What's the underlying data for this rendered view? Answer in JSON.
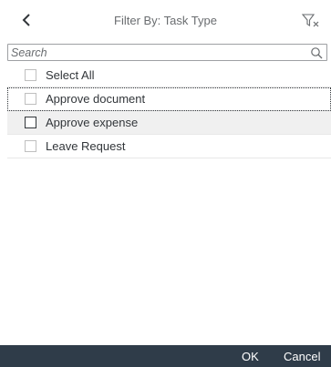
{
  "header": {
    "title": "Filter By: Task Type",
    "back_icon": "chevron-left-icon",
    "clear_filter_icon": "clear-filter-icon"
  },
  "search": {
    "placeholder": "Search",
    "value": "",
    "icon": "search-icon"
  },
  "list": {
    "items": [
      {
        "label": "Select All",
        "checked": false
      },
      {
        "label": "Approve document",
        "checked": false,
        "focused": true
      },
      {
        "label": "Approve expense",
        "checked": false,
        "hovered": true
      },
      {
        "label": "Leave Request",
        "checked": false
      }
    ]
  },
  "footer": {
    "ok_label": "OK",
    "cancel_label": "Cancel",
    "background_color": "#2f3c49"
  }
}
